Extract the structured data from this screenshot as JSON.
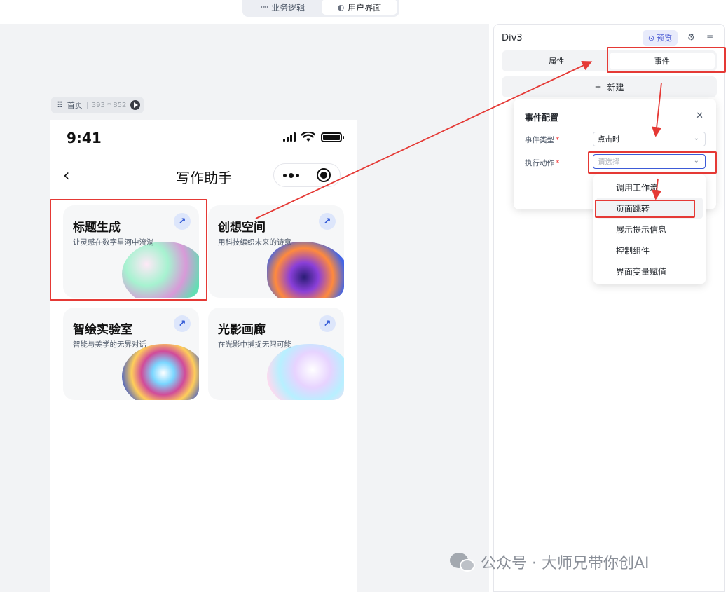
{
  "mode_tabs": [
    {
      "label": "业务逻辑",
      "icon": "flow-icon"
    },
    {
      "label": "用户界面",
      "icon": "palette-icon"
    }
  ],
  "page_chip": {
    "name": "首页",
    "dims": "393 * 852"
  },
  "phone": {
    "time": "9:41",
    "nav_title": "写作助手",
    "cards": [
      {
        "title": "标题生成",
        "subtitle": "让灵感在数字星河中流淌"
      },
      {
        "title": "创想空间",
        "subtitle": "用科技编织未来的诗意"
      },
      {
        "title": "智绘实验室",
        "subtitle": "智能与美学的无界对话"
      },
      {
        "title": "光影画廊",
        "subtitle": "在光影中捕捉无限可能"
      }
    ]
  },
  "panel": {
    "title": "Div3",
    "preview_label": "预览",
    "tabs": [
      "属性",
      "事件"
    ],
    "new_label": "新建"
  },
  "event_config": {
    "title": "事件配置",
    "event_type_label": "事件类型",
    "event_type_value": "点击时",
    "action_label": "执行动作",
    "action_placeholder": "请选择"
  },
  "dropdown_options": [
    "调用工作流",
    "页面跳转",
    "展示提示信息",
    "控制组件",
    "界面变量赋值"
  ],
  "watermark": "公众号 · 大师兄带你创AI",
  "colors": {
    "accent": "#3c5ad7",
    "annotation": "#e53935",
    "required": "#f53f3f"
  }
}
